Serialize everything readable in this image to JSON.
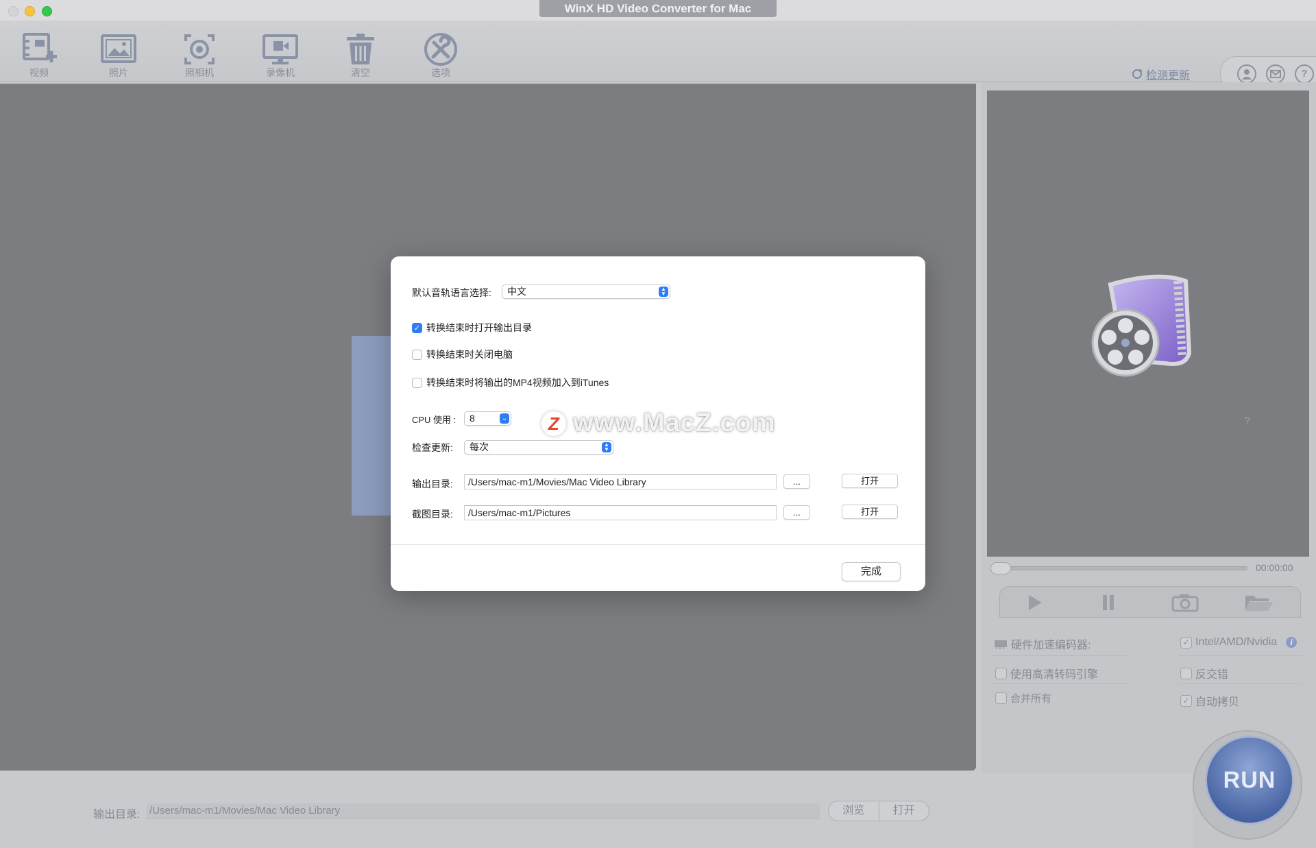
{
  "window": {
    "title": "WinX HD Video Converter for Mac"
  },
  "toolbar": {
    "buttons": [
      {
        "label": "视频",
        "icon": "add-video-icon"
      },
      {
        "label": "照片",
        "icon": "photo-icon"
      },
      {
        "label": "照相机",
        "icon": "camera-icon"
      },
      {
        "label": "录像机",
        "icon": "screen-recorder-icon"
      },
      {
        "label": "清空",
        "icon": "trash-icon"
      },
      {
        "label": "选项",
        "icon": "tools-icon"
      }
    ],
    "check_update": "检测更新",
    "right_icons": [
      "user-icon",
      "mail-icon",
      "help-icon"
    ],
    "help_glyph": "?"
  },
  "preview": {
    "time": "00:00:00",
    "question_mark": "?",
    "controls": [
      "play-icon",
      "pause-icon",
      "snapshot-icon",
      "open-folder-icon"
    ]
  },
  "options": {
    "hw_accel_label": "硬件加速编码器:",
    "intel_label": "Intel/AMD/Nvidia",
    "intel_checked": true,
    "hq_engine_label": "使用高清转码引擎",
    "hq_engine_checked": false,
    "deinterlace_label": "反交错",
    "deinterlace_checked": false,
    "merge_all_label": "合并所有",
    "merge_all_checked": false,
    "auto_copy_label": "自动拷贝",
    "auto_copy_checked": true,
    "info_glyph": "i"
  },
  "run_button": {
    "label": "RUN"
  },
  "bottom": {
    "output_label": "输出目录:",
    "output_path": "/Users/mac-m1/Movies/Mac Video Library",
    "browse_label": "浏览",
    "open_label": "打开"
  },
  "dialog": {
    "audio_lang_label": "默认音轨语言选择:",
    "audio_lang_value": "中文",
    "open_output_label": "转换结束时打开输出目录",
    "open_output_checked": true,
    "shutdown_label": "转换结束时关闭电脑",
    "shutdown_checked": false,
    "itunes_label": "转换结束时将输出的MP4视频加入到iTunes",
    "itunes_checked": false,
    "cpu_label": "CPU 使用 :",
    "cpu_value": "8",
    "check_update_label": "检查更新:",
    "check_update_value": "每次",
    "output_dir_label": "输出目录:",
    "output_dir_value": "/Users/mac-m1/Movies/Mac Video Library",
    "snapshot_dir_label": "截图目录:",
    "snapshot_dir_value": "/Users/mac-m1/Pictures",
    "browse_label": "...",
    "open_label": "打开",
    "done_label": "完成",
    "checkmark": "✓"
  },
  "watermark": {
    "logo_letter": "Z",
    "text": "www.MacZ.com"
  },
  "colors": {
    "accent": "#2f7cf6",
    "run_blue": "#4b66a5",
    "main_bg": "#7c7d81"
  }
}
